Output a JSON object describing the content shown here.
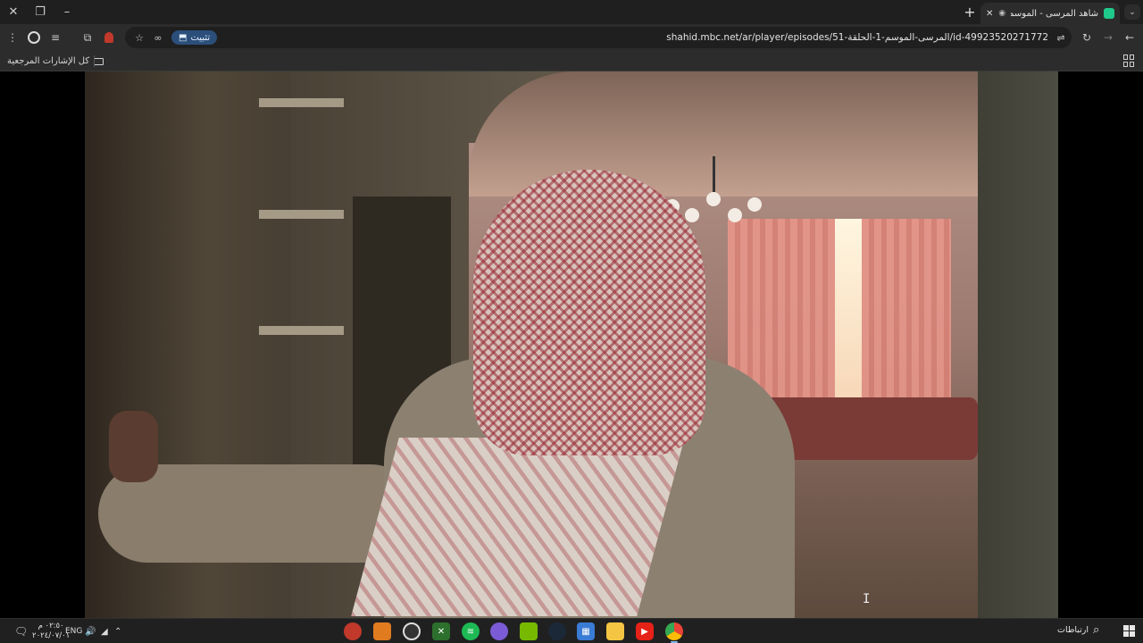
{
  "browser": {
    "tab": {
      "title": "شاهد المرسى - الموسم 1 / الـ",
      "audio_icon": "speaker-icon",
      "close_icon": "close-icon"
    },
    "window_controls": {
      "close": "✕",
      "restore": "❐",
      "minimize": "–"
    },
    "new_tab": "+",
    "tab_search": "⌄",
    "toolbar": {
      "url": "shahid.mbc.net/ar/player/episodes/المرسى-الموسم-1-الحلقة-51/id-49923520271772",
      "install_label": "تثبيت",
      "reload": "↻",
      "back": "←",
      "forward": "→",
      "star": "☆",
      "menu": "⋮"
    },
    "bookmarks_bar": {
      "all_bookmarks_label": "كل الإشارات المرجعية"
    }
  },
  "taskbar": {
    "widgets_label": "ارتباطات",
    "language": "ENG",
    "time": "٠٢:٥٠ م",
    "date": "٢٠٢٤/٠٧/٠١",
    "apps": [
      {
        "name": "chrome",
        "color": "#4285f4"
      },
      {
        "name": "youtube",
        "color": "#e62117"
      },
      {
        "name": "file-explorer",
        "color": "#f4c542"
      },
      {
        "name": "store",
        "color": "#3a7bd5"
      },
      {
        "name": "steam",
        "color": "#1b2838"
      },
      {
        "name": "nvidia",
        "color": "#76b900"
      },
      {
        "name": "app-purple",
        "color": "#7b5cd6"
      },
      {
        "name": "spotify",
        "color": "#1db954"
      },
      {
        "name": "xbox",
        "color": "#2d6f2d"
      },
      {
        "name": "davinci",
        "color": "#333333"
      },
      {
        "name": "app-orange",
        "color": "#e07b20"
      },
      {
        "name": "app-red",
        "color": "#c0392b"
      }
    ]
  }
}
